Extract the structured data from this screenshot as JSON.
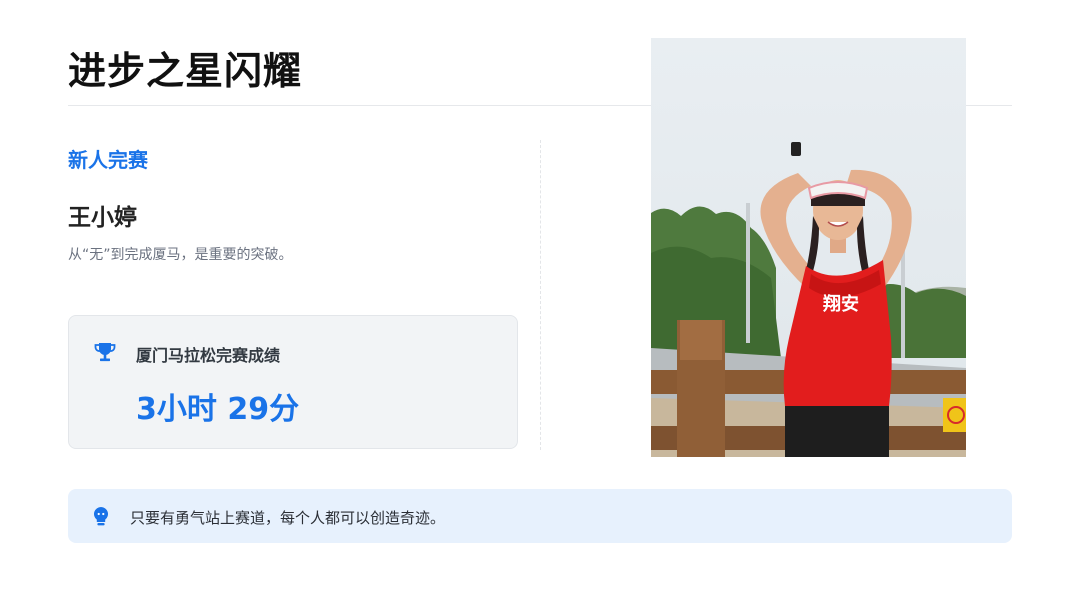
{
  "header": {
    "title": "进步之星闪耀"
  },
  "profile": {
    "category": "新人完赛",
    "name": "王小婷",
    "description": "从“无”到完成厦马，是重要的突破。"
  },
  "result_card": {
    "icon": "trophy-icon",
    "label": "厦门马拉松完赛成绩",
    "value": "3小时 29分"
  },
  "photo": {
    "shirt_text": "翔安"
  },
  "quote": {
    "icon": "lightbulb-icon",
    "text": "只要有勇气站上赛道，每个人都可以创造奇迹。"
  },
  "colors": {
    "accent": "#1a73e8",
    "quote_bg": "#e7f1fd",
    "card_bg": "#f2f4f6"
  }
}
